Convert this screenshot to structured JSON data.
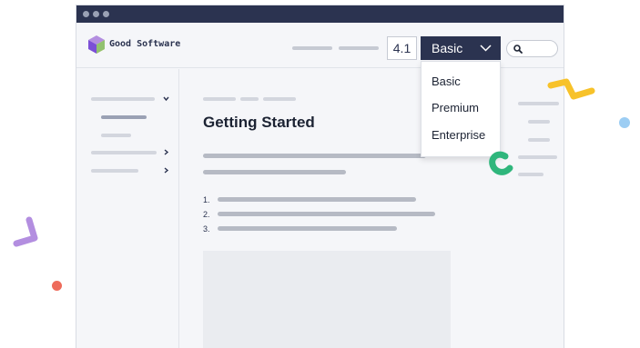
{
  "app": {
    "brand_name": "Good Software"
  },
  "header": {
    "version": "4.1",
    "edition_selected": "Basic"
  },
  "dropdown": {
    "options": [
      "Basic",
      "Premium",
      "Enterprise"
    ]
  },
  "page": {
    "title": "Getting Started",
    "list_numbers": [
      "1.",
      "2.",
      "3."
    ]
  },
  "colors": {
    "navy": "#2b3350",
    "decor_yellow": "#f7c22a",
    "decor_orange": "#f7a12a",
    "decor_purple": "#b38ee0",
    "decor_green": "#2fb67c",
    "decor_blue": "#9ccdf3",
    "decor_red": "#ee6b5b"
  },
  "icons": [
    "cube-logo-icon",
    "chevron-down-icon",
    "search-icon",
    "chevron-right-icon"
  ]
}
